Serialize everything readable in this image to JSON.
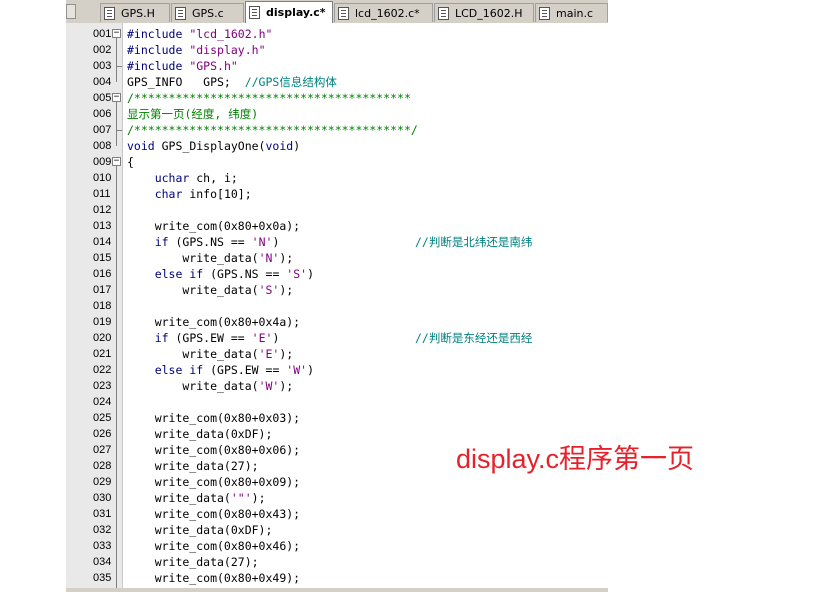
{
  "tabs": [
    {
      "label": "GPS.H",
      "active": false
    },
    {
      "label": "GPS.c",
      "active": false
    },
    {
      "label": "display.c*",
      "active": true
    },
    {
      "label": "lcd_1602.c*",
      "active": false
    },
    {
      "label": "LCD_1602.H",
      "active": false
    },
    {
      "label": "main.c",
      "active": false
    }
  ],
  "code_lines": [
    {
      "num": "001",
      "text": "#include \"lcd_1602.h\""
    },
    {
      "num": "002",
      "text": "#include \"display.h\""
    },
    {
      "num": "003",
      "text": "#include \"GPS.h\""
    },
    {
      "num": "004",
      "text": "GPS_INFO   GPS;  //GPS信息结构体"
    },
    {
      "num": "005",
      "text": "/****************************************"
    },
    {
      "num": "006",
      "text": "显示第一页(经度, 纬度)"
    },
    {
      "num": "007",
      "text": "/****************************************/"
    },
    {
      "num": "008",
      "text": "void GPS_DisplayOne(void)"
    },
    {
      "num": "009",
      "text": "{"
    },
    {
      "num": "010",
      "text": "    uchar ch, i;"
    },
    {
      "num": "011",
      "text": "    char info[10];"
    },
    {
      "num": "012",
      "text": ""
    },
    {
      "num": "013",
      "text": "    write_com(0x80+0x0a);"
    },
    {
      "num": "014",
      "text": "    if (GPS.NS == 'N')",
      "comment": "//判断是北纬还是南纬"
    },
    {
      "num": "015",
      "text": "        write_data('N');"
    },
    {
      "num": "016",
      "text": "    else if (GPS.NS == 'S')"
    },
    {
      "num": "017",
      "text": "        write_data('S');"
    },
    {
      "num": "018",
      "text": ""
    },
    {
      "num": "019",
      "text": "    write_com(0x80+0x4a);"
    },
    {
      "num": "020",
      "text": "    if (GPS.EW == 'E')",
      "comment": "//判断是东经还是西经"
    },
    {
      "num": "021",
      "text": "        write_data('E');"
    },
    {
      "num": "022",
      "text": "    else if (GPS.EW == 'W')"
    },
    {
      "num": "023",
      "text": "        write_data('W');"
    },
    {
      "num": "024",
      "text": ""
    },
    {
      "num": "025",
      "text": "    write_com(0x80+0x03);"
    },
    {
      "num": "026",
      "text": "    write_data(0xDF);"
    },
    {
      "num": "027",
      "text": "    write_com(0x80+0x06);"
    },
    {
      "num": "028",
      "text": "    write_data(27);"
    },
    {
      "num": "029",
      "text": "    write_com(0x80+0x09);"
    },
    {
      "num": "030",
      "text": "    write_data('\"');"
    },
    {
      "num": "031",
      "text": "    write_com(0x80+0x43);"
    },
    {
      "num": "032",
      "text": "    write_data(0xDF);"
    },
    {
      "num": "033",
      "text": "    write_com(0x80+0x46);"
    },
    {
      "num": "034",
      "text": "    write_data(27);"
    },
    {
      "num": "035",
      "text": "    write_com(0x80+0x49);"
    }
  ],
  "annotation": "display.c程序第一页",
  "colors": {
    "keyword": "#000080",
    "string": "#800080",
    "comment": "#008080",
    "block_comment": "#008000",
    "annotation": "#e8202a"
  }
}
